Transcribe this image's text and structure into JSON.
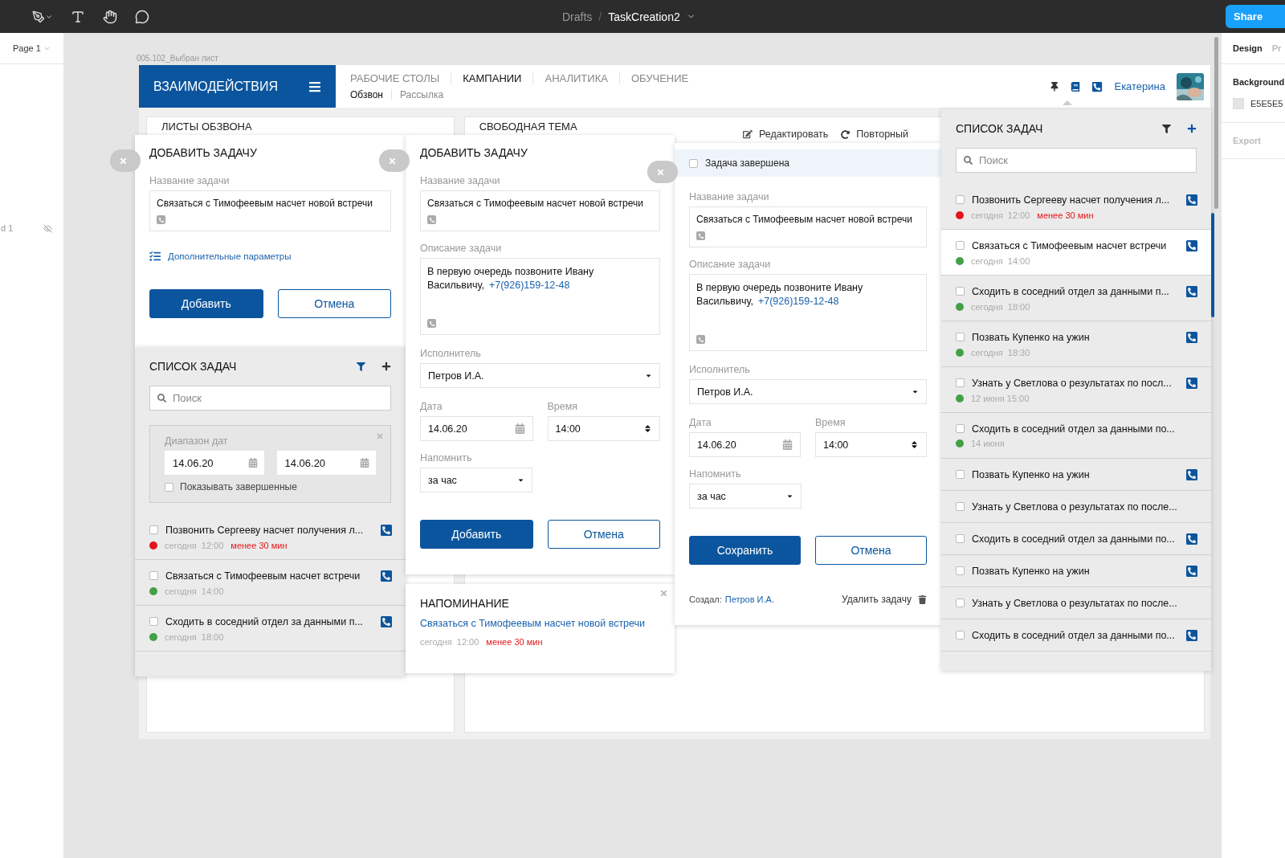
{
  "editor": {
    "breadcrumb": {
      "folder": "Drafts",
      "separator": "/",
      "file": "TaskCreation2"
    },
    "share": "Share",
    "page": "Page 1",
    "layer": "d 1",
    "frame_label": "005.102_Выбран лист",
    "inspector": {
      "tabs": [
        {
          "label": "Design",
          "selected": true
        },
        {
          "label": "Pr",
          "selected": false
        }
      ],
      "background_label": "Background",
      "background_value": "E5E5E5",
      "export": "Export"
    }
  },
  "app": {
    "logo": "ВЗАИМОДЕЙСТВИЯ",
    "nav": [
      {
        "label": "РАБОЧИЕ СТОЛЫ",
        "selected": false
      },
      {
        "label": "КАМПАНИИ",
        "selected": true
      },
      {
        "label": "АНАЛИТИКА",
        "selected": false
      },
      {
        "label": "ОБУЧЕНИЕ",
        "selected": false
      }
    ],
    "subnav": [
      {
        "label": "Обзвон",
        "selected": true
      },
      {
        "label": "Рассылка",
        "selected": false
      }
    ],
    "user": "Екатерина",
    "panels": [
      {
        "title": "ЛИСТЫ ОБЗВОНА"
      },
      {
        "title": "СВОБОДНАЯ ТЕМА",
        "actions": [
          "Редактировать",
          "Повторный"
        ]
      }
    ]
  },
  "add_task_short": {
    "title": "ДОБАВИТЬ ЗАДАЧУ",
    "name_label": "Название задачи",
    "name_value": "Связаться с Тимофеевым насчет новой встречи",
    "more": "Дополнительные параметры",
    "buttons": [
      {
        "label": "Добавить",
        "kind": "primary"
      },
      {
        "label": "Отмена",
        "kind": "secondary"
      }
    ]
  },
  "task_list_left": {
    "title": "СПИСОК ЗАДАЧ",
    "filter_active": true,
    "search_placeholder": "Поиск",
    "date_filter": {
      "label": "Диапазон дат",
      "from": "14.06.20",
      "to": "14.06.20",
      "show_completed": {
        "label": "Показывать завершенные",
        "checked": false
      }
    },
    "tasks": [
      {
        "title": "Позвонить Сергееву насчет получения л...",
        "checked": false,
        "selected": false,
        "color": "#e3151a",
        "when": "сегодня  12:00",
        "warning": "менее 30 мин",
        "phone": true
      },
      {
        "title": "Связаться с Тимофеевым насчет встречи",
        "checked": false,
        "selected": false,
        "color": "#43a047",
        "when": "сегодня  14:00",
        "phone": true
      },
      {
        "title": "Сходить в соседний отдел за данными п...",
        "checked": false,
        "selected": false,
        "color": "#43a047",
        "when": "сегодня  18:00",
        "phone": true
      }
    ]
  },
  "add_task_full": {
    "title": "ДОБАВИТЬ ЗАДАЧУ",
    "name_label": "Название задачи",
    "name_value": "Связаться с Тимофеевым насчет новой встречи",
    "description_label": "Описание задачи",
    "description_text": "В первую очередь позвоните Ивану Васильвичу,",
    "description_phone": "+7(926)159-12-48",
    "assignee_label": "Исполнитель",
    "assignee_value": "Петров И.А.",
    "date_label": "Дата",
    "date_value": "14.06.20",
    "time_label": "Время",
    "time_value": "14:00",
    "remind_label": "Напомнить",
    "remind_value": "за час",
    "buttons": [
      {
        "label": "Добавить",
        "kind": "primary"
      },
      {
        "label": "Отмена",
        "kind": "secondary"
      }
    ]
  },
  "reminder": {
    "title": "НАПОМИНАНИЕ",
    "task": "Связаться с Тимофеевым насчет новой встречи",
    "when": "сегодня  12:00",
    "warning": "менее 30 мин"
  },
  "edit_task": {
    "done": {
      "label": "Задача завершена",
      "checked": false
    },
    "name_label": "Название задачи",
    "name_value": "Связаться с Тимофеевым насчет новой встречи",
    "description_label": "Описание задачи",
    "description_text": "В первую очередь позвоните Ивану Васильвичу,",
    "description_phone": "+7(926)159-12-48",
    "assignee_label": "Исполнитель",
    "assignee_value": "Петров И.А.",
    "date_label": "Дата",
    "date_value": "14.06.20",
    "time_label": "Время",
    "time_value": "14:00",
    "remind_label": "Напомнить",
    "remind_value": "за час",
    "buttons": [
      {
        "label": "Сохранить",
        "kind": "primary"
      },
      {
        "label": "Отмена",
        "kind": "secondary"
      }
    ],
    "author_label": "Создал:",
    "author": "Петров И.А.",
    "delete": "Удалить задачу"
  },
  "task_list_right": {
    "title": "СПИСОК ЗАДАЧ",
    "filter_active": false,
    "search_placeholder": "Поиск",
    "tasks": [
      {
        "title": "Позвонить Сергееву насчет получения л...",
        "checked": false,
        "selected": false,
        "color": "#e3151a",
        "when": "сегодня  12:00",
        "warning": "менее 30 мин",
        "phone": true
      },
      {
        "title": "Связаться с Тимофеевым насчет встречи",
        "checked": false,
        "selected": true,
        "color": "#43a047",
        "when": "сегодня  14:00",
        "phone": true
      },
      {
        "title": "Сходить в соседний отдел за данными п...",
        "checked": false,
        "selected": false,
        "color": "#43a047",
        "when": "сегодня  18:00",
        "phone": true
      },
      {
        "title": "Позвать Купенко на ужин",
        "checked": false,
        "selected": false,
        "color": "#43a047",
        "when": "сегодня  18:30",
        "phone": true
      },
      {
        "title": "Узнать у Светлова о результатах по посл...",
        "checked": false,
        "selected": false,
        "color": "#43a047",
        "when": "12 июня 15:00",
        "phone": true
      },
      {
        "title": "Сходить в соседний отдел за данными по...",
        "checked": false,
        "selected": false,
        "color": "#43a047",
        "when": "14 июня",
        "phone": false
      },
      {
        "title": "Позвать Купенко на ужин",
        "checked": false,
        "selected": false,
        "phone": true
      },
      {
        "title": "Узнать у Светлова о результатах по после...",
        "checked": false,
        "selected": false,
        "phone": false
      },
      {
        "title": "Сходить в соседний отдел за данными по...",
        "checked": false,
        "selected": false,
        "phone": true
      },
      {
        "title": "Позвать Купенко на ужин",
        "checked": false,
        "selected": false,
        "phone": true
      },
      {
        "title": "Узнать у Светлова о результатах по после...",
        "checked": false,
        "selected": false,
        "phone": false
      },
      {
        "title": "Сходить в соседний отдел за данными по...",
        "checked": false,
        "selected": false,
        "phone": true
      }
    ]
  }
}
